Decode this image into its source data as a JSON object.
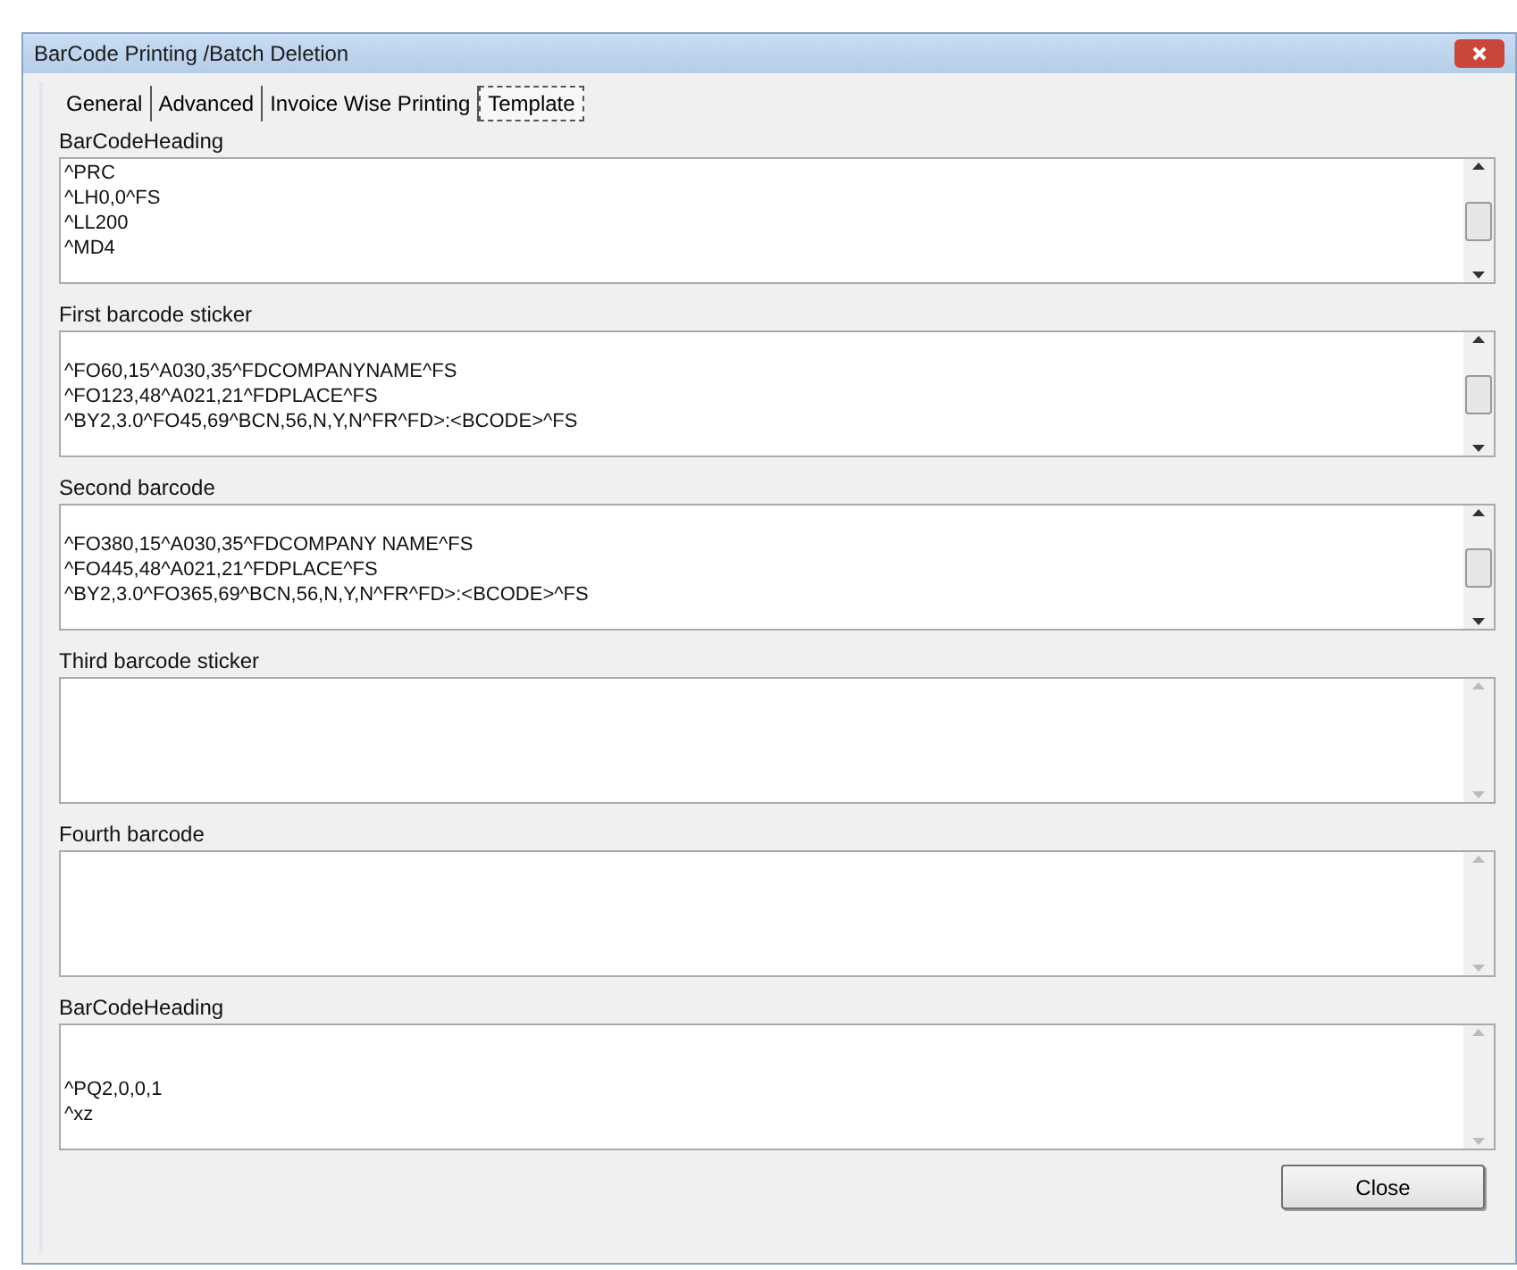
{
  "window": {
    "title": "BarCode Printing /Batch Deletion"
  },
  "tabs": [
    {
      "label": "General",
      "selected": false
    },
    {
      "label": "Advanced",
      "selected": false
    },
    {
      "label": "Invoice Wise Printing",
      "selected": false
    },
    {
      "label": "Template",
      "selected": true
    }
  ],
  "fields": [
    {
      "label": "BarCodeHeading",
      "value": "^PRC\n^LH0,0^FS\n^LL200\n^MD4",
      "scrollable": true
    },
    {
      "label": "First barcode sticker",
      "value": "\n^FO60,15^A030,35^FDCOMPANYNAME^FS\n^FO123,48^A021,21^FDPLACE^FS\n^BY2,3.0^FO45,69^BCN,56,N,Y,N^FR^FD>:<BCODE>^FS",
      "scrollable": true
    },
    {
      "label": "Second barcode",
      "value": "\n^FO380,15^A030,35^FDCOMPANY NAME^FS\n^FO445,48^A021,21^FDPLACE^FS\n^BY2,3.0^FO365,69^BCN,56,N,Y,N^FR^FD>:<BCODE>^FS",
      "scrollable": true
    },
    {
      "label": "Third barcode sticker",
      "scrollable": false
    },
    {
      "label": "Fourth barcode",
      "scrollable": false
    },
    {
      "label": "BarCodeHeading",
      "value": "\n\n^PQ2,0,0,1\n^xz",
      "scrollable": false
    }
  ],
  "buttons": [
    {
      "label": "Close"
    }
  ]
}
